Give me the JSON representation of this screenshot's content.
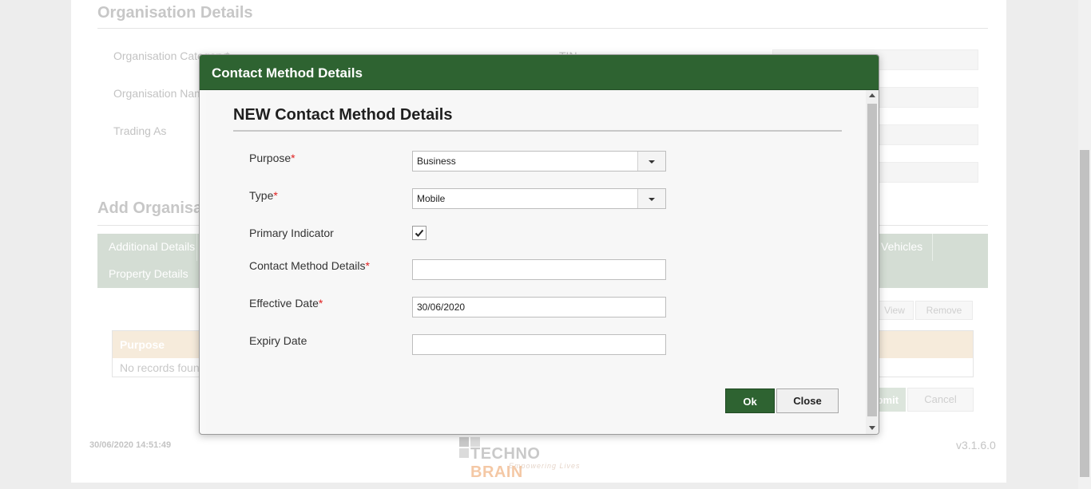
{
  "background": {
    "section_title": "Organisation Details",
    "fields": {
      "org_category": "Organisation Category*",
      "tin": "TIN",
      "org_name": "Organisation Name",
      "trading_as": "Trading As"
    },
    "add_section_title": "Add Organisation",
    "tabs": {
      "additional_details": "Additional Details",
      "vehicles": "Vehicles",
      "property_details": "Property Details"
    },
    "grid_actions": {
      "view": "View",
      "remove": "Remove"
    },
    "grid": {
      "header": "Purpose",
      "empty_text": "No records found"
    },
    "buttons": {
      "submit": "Submit",
      "cancel": "Cancel"
    }
  },
  "footer": {
    "timestamp": "30/06/2020 14:51:49",
    "version": "v3.1.6.0",
    "logo_text_1": "TECHNO",
    "logo_text_2": "BRAIN",
    "logo_tagline": "Empowering Lives"
  },
  "modal": {
    "title": "Contact Method Details",
    "heading": "NEW Contact Method Details",
    "required_marker": "*",
    "fields": {
      "purpose": {
        "label": "Purpose",
        "required": true,
        "value": "Business"
      },
      "type": {
        "label": "Type",
        "required": true,
        "value": "Mobile"
      },
      "primary_indicator": {
        "label": "Primary Indicator",
        "checked": true
      },
      "contact_method_details": {
        "label": "Contact Method Details",
        "required": true,
        "value": ""
      },
      "effective_date": {
        "label": "Effective Date",
        "required": true,
        "value": "30/06/2020"
      },
      "expiry_date": {
        "label": "Expiry Date",
        "required": false,
        "value": ""
      }
    },
    "buttons": {
      "ok": "Ok",
      "close": "Close"
    }
  },
  "colors": {
    "header_green": "#2e6331",
    "required_red": "#e02020"
  }
}
